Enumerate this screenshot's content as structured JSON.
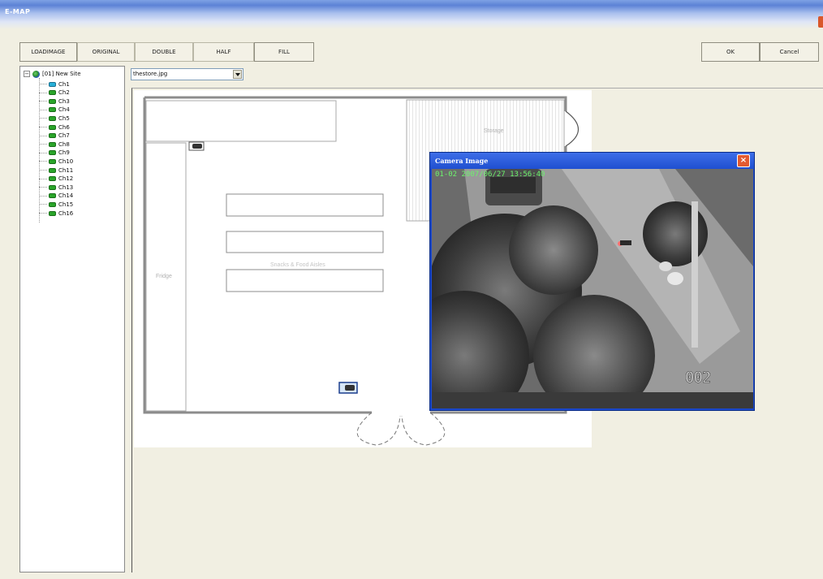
{
  "window": {
    "title": "E-MAP"
  },
  "toolbar": {
    "load_image": "LOADIMAGE",
    "original": "ORIGINAL",
    "double": "DOUBLE",
    "half": "HALF",
    "fill": "FILL",
    "ok": "OK",
    "cancel": "Cancel"
  },
  "tree": {
    "root": "[01] New Site",
    "expander": "−",
    "channels": [
      {
        "label": "Ch1",
        "active": true
      },
      {
        "label": "Ch2"
      },
      {
        "label": "Ch3"
      },
      {
        "label": "Ch4"
      },
      {
        "label": "Ch5"
      },
      {
        "label": "Ch6"
      },
      {
        "label": "Ch7"
      },
      {
        "label": "Ch8"
      },
      {
        "label": "Ch9"
      },
      {
        "label": "Ch10"
      },
      {
        "label": "Ch11"
      },
      {
        "label": "Ch12"
      },
      {
        "label": "Ch13"
      },
      {
        "label": "Ch14"
      },
      {
        "label": "Ch15"
      },
      {
        "label": "Ch16"
      }
    ]
  },
  "map": {
    "file": "thestore.jpg",
    "labels": {
      "storage": "Storage",
      "fridge": "Fridge",
      "aisles": "Snacks & Food Aisles"
    }
  },
  "camera_popup": {
    "title": "Camera Image",
    "timestamp": "01-02 2007/06/27 13:56:40",
    "camera_number": "002"
  },
  "colors": {
    "titlebar": "#5c82d6",
    "popup_frame": "#1c48c9",
    "osd_text": "#6cf36c",
    "cam_icon": "#2aa52a",
    "cam_icon_active": "#28b0d8"
  },
  "icons": {
    "site": "globe-icon",
    "channel": "camera-icon",
    "close": "close-icon",
    "dropdown": "chevron-down-icon"
  }
}
